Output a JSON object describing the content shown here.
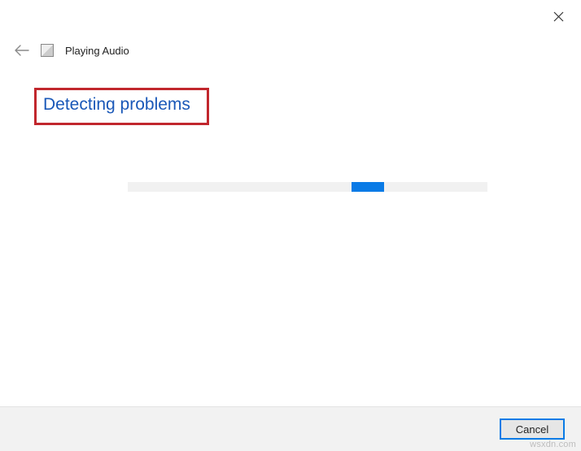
{
  "window": {
    "title": "Playing Audio"
  },
  "content": {
    "status": "Detecting problems"
  },
  "footer": {
    "cancel_label": "Cancel"
  },
  "watermark": "wsxdn.com",
  "colors": {
    "accent": "#0a7be6",
    "highlight_box": "#c1272d",
    "status_text": "#1a58b8"
  }
}
